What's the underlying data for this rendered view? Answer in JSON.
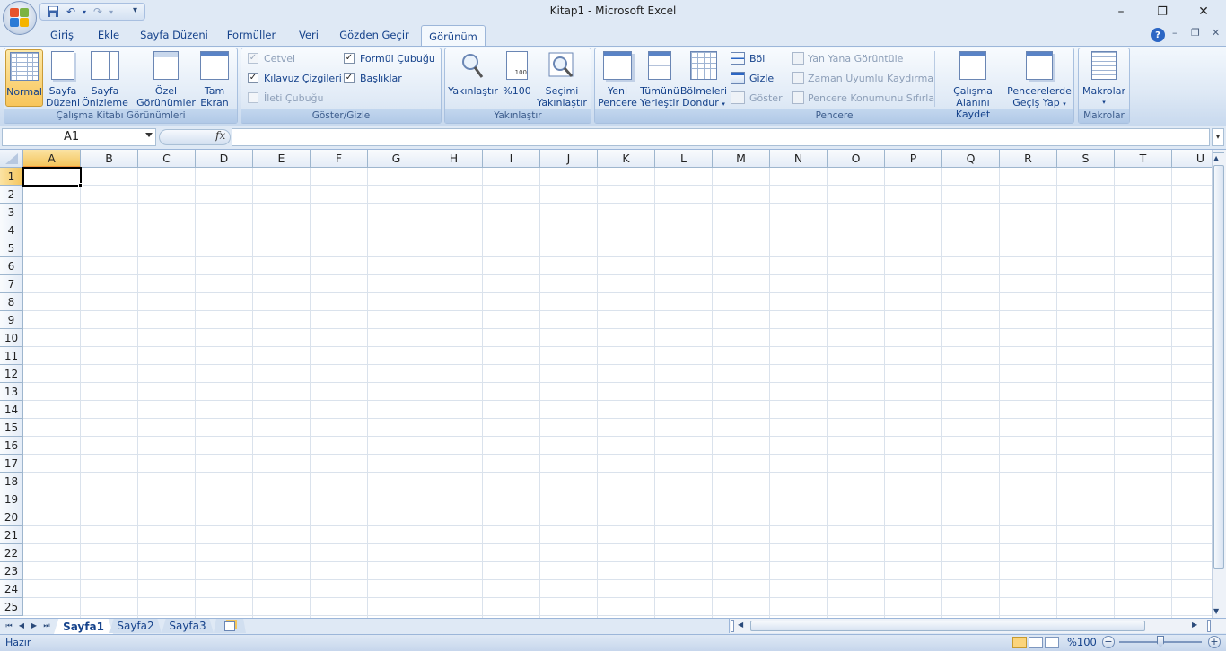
{
  "window": {
    "title": "Kitap1 - Microsoft Excel",
    "minimize_icon": "–",
    "restore_icon": "❐",
    "close_icon": "✕"
  },
  "qat": {
    "customize_icon": "▾"
  },
  "tabs": [
    {
      "label": "Giriş"
    },
    {
      "label": "Ekle"
    },
    {
      "label": "Sayfa Düzeni"
    },
    {
      "label": "Formüller"
    },
    {
      "label": "Veri"
    },
    {
      "label": "Gözden Geçir"
    },
    {
      "label": "Görünüm",
      "active": true
    }
  ],
  "ribbon": {
    "groups": {
      "workbook_views": {
        "label": "Çalışma Kitabı Görünümleri",
        "normal": "Normal",
        "page_layout": [
          "Sayfa",
          "Düzeni"
        ],
        "page_break": [
          "Sayfa",
          "Önizleme"
        ],
        "custom_views": [
          "Özel",
          "Görünümler"
        ],
        "full_screen": [
          "Tam",
          "Ekran"
        ]
      },
      "show_hide": {
        "label": "Göster/Gizle",
        "ruler": {
          "label": "Cetvel",
          "checked": true,
          "disabled": true
        },
        "gridlines": {
          "label": "Kılavuz Çizgileri",
          "checked": true
        },
        "message_bar": {
          "label": "İleti Çubuğu",
          "checked": false,
          "disabled": true
        },
        "formula_bar": {
          "label": "Formül Çubuğu",
          "checked": true
        },
        "headings": {
          "label": "Başlıklar",
          "checked": true
        }
      },
      "zoom": {
        "label": "Yakınlaştır",
        "zoom_btn": "Yakınlaştır",
        "hundred": "%100",
        "zoom_sel": [
          "Seçimi",
          "Yakınlaştır"
        ]
      },
      "window": {
        "label": "Pencere",
        "new_window": [
          "Yeni",
          "Pencere"
        ],
        "arrange_all": [
          "Tümünü",
          "Yerleştir"
        ],
        "freeze_panes": [
          "Bölmeleri",
          "Dondur"
        ],
        "split": "Böl",
        "hide": "Gizle",
        "unhide": "Göster",
        "side_by_side": "Yan Yana Görüntüle",
        "sync_scroll": "Zaman Uyumlu Kaydırma",
        "reset_pos": "Pencere Konumunu Sıfırla",
        "save_workspace": [
          "Çalışma",
          "Alanını Kaydet"
        ],
        "switch_windows": [
          "Pencerelerde",
          "Geçiş Yap"
        ]
      },
      "macros": {
        "label": "Makrolar",
        "macros_btn": "Makrolar"
      }
    }
  },
  "formula_bar": {
    "name_box": "A1",
    "fx": "fx",
    "value": ""
  },
  "grid": {
    "columns": [
      "A",
      "B",
      "C",
      "D",
      "E",
      "F",
      "G",
      "H",
      "I",
      "J",
      "K",
      "L",
      "M",
      "N",
      "O",
      "P",
      "Q",
      "R",
      "S",
      "T",
      "U"
    ],
    "rows": [
      "1",
      "2",
      "3",
      "4",
      "5",
      "6",
      "7",
      "8",
      "9",
      "10",
      "11",
      "12",
      "13",
      "14",
      "15",
      "16",
      "17",
      "18",
      "19",
      "20",
      "21",
      "22",
      "23",
      "24",
      "25"
    ],
    "active_cell": "A1"
  },
  "sheets": [
    {
      "label": "Sayfa1",
      "active": true
    },
    {
      "label": "Sayfa2"
    },
    {
      "label": "Sayfa3"
    }
  ],
  "status": {
    "text": "Hazır",
    "zoom": "%100",
    "zoom_minus": "−",
    "zoom_plus": "+",
    "zoom_level": 100
  },
  "colors": {
    "ribbon_text": "#15428b",
    "title_bg": "#dfe9f5",
    "selection_header": "#f4c55c"
  }
}
